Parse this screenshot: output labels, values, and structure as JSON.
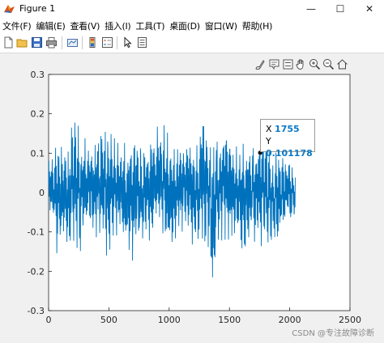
{
  "window": {
    "title": "Figure 1",
    "controls": {
      "minimize": "—",
      "maximize": "☐",
      "close": "✕"
    }
  },
  "menu": {
    "items": [
      "文件(F)",
      "编辑(E)",
      "查看(V)",
      "插入(I)",
      "工具(T)",
      "桌面(D)",
      "窗口(W)",
      "帮助(H)"
    ]
  },
  "toolbar": {
    "icons": [
      "new-figure-icon",
      "open-file-icon",
      "save-icon",
      "print-icon",
      "link-plot-icon",
      "colorbar-icon",
      "legend-icon",
      "pointer-icon",
      "property-inspector-icon"
    ]
  },
  "axes_toolbar": {
    "icons": [
      "brush-icon",
      "data-tips-icon",
      "legend-toggle-icon",
      "pan-icon",
      "zoom-in-icon",
      "zoom-out-icon",
      "home-icon"
    ]
  },
  "datatip": {
    "x_label": "X",
    "x_value": "1755",
    "y_label": "Y",
    "y_value": "0.101178"
  },
  "watermark": "CSDN @专注故障诊断",
  "colors": {
    "line": "#0072bd",
    "datatip_value": "#0a7ac4"
  },
  "chart_data": {
    "type": "line",
    "xlim": [
      0,
      2500
    ],
    "ylim": [
      -0.3,
      0.3
    ],
    "x_ticks": [
      "0",
      "500",
      "1000",
      "1500",
      "2000",
      "2500"
    ],
    "y_ticks": [
      "0.3",
      "0.2",
      "0.1",
      "0",
      "-0.1",
      "-0.2",
      "-0.3"
    ],
    "n_points": 2048,
    "envelope": [
      {
        "x": 0,
        "min": -0.04,
        "max": 0.08
      },
      {
        "x": 50,
        "min": -0.1,
        "max": 0.1
      },
      {
        "x": 80,
        "min": -0.19,
        "max": 0.16
      },
      {
        "x": 120,
        "min": -0.12,
        "max": 0.12
      },
      {
        "x": 170,
        "min": -0.17,
        "max": 0.11
      },
      {
        "x": 210,
        "min": -0.12,
        "max": 0.22
      },
      {
        "x": 260,
        "min": -0.16,
        "max": 0.15
      },
      {
        "x": 320,
        "min": -0.11,
        "max": 0.14
      },
      {
        "x": 380,
        "min": -0.12,
        "max": 0.13
      },
      {
        "x": 430,
        "min": -0.1,
        "max": 0.16
      },
      {
        "x": 480,
        "min": -0.16,
        "max": 0.18
      },
      {
        "x": 540,
        "min": -0.14,
        "max": 0.14
      },
      {
        "x": 600,
        "min": -0.11,
        "max": 0.12
      },
      {
        "x": 650,
        "min": -0.16,
        "max": 0.13
      },
      {
        "x": 700,
        "min": -0.19,
        "max": 0.17
      },
      {
        "x": 760,
        "min": -0.14,
        "max": 0.14
      },
      {
        "x": 820,
        "min": -0.13,
        "max": 0.13
      },
      {
        "x": 880,
        "min": -0.1,
        "max": 0.16
      },
      {
        "x": 940,
        "min": -0.12,
        "max": 0.18
      },
      {
        "x": 1000,
        "min": -0.17,
        "max": 0.15
      },
      {
        "x": 1060,
        "min": -0.12,
        "max": 0.12
      },
      {
        "x": 1120,
        "min": -0.1,
        "max": 0.13
      },
      {
        "x": 1170,
        "min": -0.11,
        "max": 0.14
      },
      {
        "x": 1220,
        "min": -0.16,
        "max": 0.12
      },
      {
        "x": 1270,
        "min": -0.14,
        "max": 0.21
      },
      {
        "x": 1330,
        "min": -0.16,
        "max": 0.16
      },
      {
        "x": 1360,
        "min": -0.27,
        "max": 0.12
      },
      {
        "x": 1400,
        "min": -0.12,
        "max": 0.14
      },
      {
        "x": 1460,
        "min": -0.13,
        "max": 0.18
      },
      {
        "x": 1520,
        "min": -0.11,
        "max": 0.13
      },
      {
        "x": 1570,
        "min": -0.13,
        "max": 0.14
      },
      {
        "x": 1630,
        "min": -0.17,
        "max": 0.14
      },
      {
        "x": 1690,
        "min": -0.12,
        "max": 0.12
      },
      {
        "x": 1755,
        "min": -0.14,
        "max": 0.16
      },
      {
        "x": 1800,
        "min": -0.12,
        "max": 0.15
      },
      {
        "x": 1860,
        "min": -0.14,
        "max": 0.1
      },
      {
        "x": 1920,
        "min": -0.12,
        "max": 0.11
      },
      {
        "x": 1980,
        "min": -0.08,
        "max": 0.09
      },
      {
        "x": 2048,
        "min": -0.07,
        "max": 0.06
      }
    ],
    "datatip_point": {
      "x": 1755,
      "y": 0.101178
    }
  }
}
